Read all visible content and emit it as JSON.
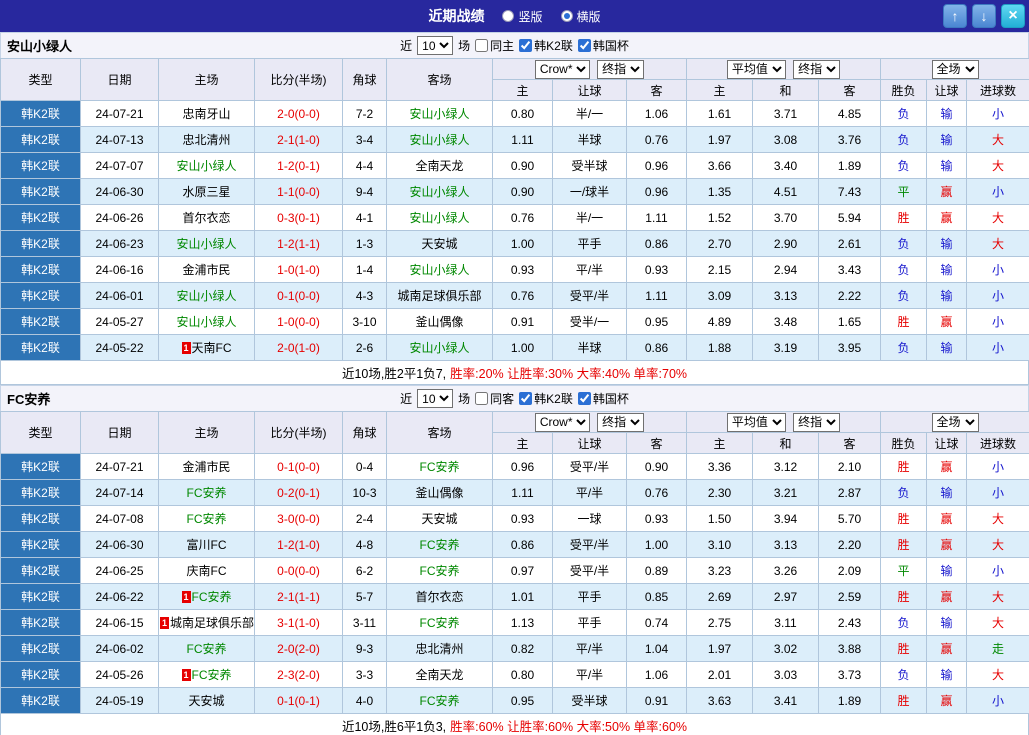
{
  "titlebar": {
    "title": "近期战绩",
    "modes": [
      {
        "label": "竖版",
        "selected": false
      },
      {
        "label": "横版",
        "selected": true
      }
    ],
    "up_icon": "↑",
    "down_icon": "↓",
    "close_icon": "×"
  },
  "badge_label": "1",
  "colors": {
    "red": "#E60000",
    "blue": "#1515CD",
    "green": "#008800",
    "type_bg": "#2E74B5"
  },
  "result_color_map": {
    "胜": "red",
    "平": "green",
    "负": "blue",
    "赢": "red",
    "输": "blue",
    "大": "red",
    "小": "blue",
    "走": "green"
  },
  "table_header": {
    "type": "类型",
    "date": "日期",
    "home": "主场",
    "score": "比分(半场)",
    "corner": "角球",
    "away": "客场",
    "bookmaker_select": "Crow*",
    "final_select": "终指",
    "avg_select": "平均值",
    "final_select2": "终指",
    "fullmatch_select": "全场",
    "sub": {
      "home": "主",
      "handicap": "让球",
      "away": "客",
      "home2": "主",
      "draw": "和",
      "away2": "客",
      "result": "胜负",
      "handicap_result": "让球",
      "goals": "进球数"
    }
  },
  "sections": [
    {
      "team": "安山小绿人",
      "filters": {
        "recent_label": "近",
        "recent_value": "10",
        "matches_label": "场",
        "same_label": "同主",
        "same_checked": false,
        "league_label": "韩K2联",
        "league_checked": true,
        "cup_label": "韩国杯",
        "cup_checked": true
      },
      "rows": [
        {
          "league": "韩K2联",
          "date": "24-07-21",
          "home": "忠南牙山",
          "home_focus": false,
          "home_badge": false,
          "score": "2-0(0-0)",
          "corner": "7-2",
          "away": "安山小绿人",
          "away_focus": true,
          "asian": [
            "0.80",
            "半/一",
            "1.06"
          ],
          "euro": [
            "1.61",
            "3.71",
            "4.85"
          ],
          "results": [
            "负",
            "输",
            "小"
          ]
        },
        {
          "league": "韩K2联",
          "date": "24-07-13",
          "home": "忠北清州",
          "home_focus": false,
          "home_badge": false,
          "score": "2-1(1-0)",
          "corner": "3-4",
          "away": "安山小绿人",
          "away_focus": true,
          "asian": [
            "1.11",
            "半球",
            "0.76"
          ],
          "euro": [
            "1.97",
            "3.08",
            "3.76"
          ],
          "results": [
            "负",
            "输",
            "大"
          ]
        },
        {
          "league": "韩K2联",
          "date": "24-07-07",
          "home": "安山小绿人",
          "home_focus": true,
          "home_badge": false,
          "score": "1-2(0-1)",
          "corner": "4-4",
          "away": "全南天龙",
          "away_focus": false,
          "asian": [
            "0.90",
            "受半球",
            "0.96"
          ],
          "euro": [
            "3.66",
            "3.40",
            "1.89"
          ],
          "results": [
            "负",
            "输",
            "大"
          ]
        },
        {
          "league": "韩K2联",
          "date": "24-06-30",
          "home": "水原三星",
          "home_focus": false,
          "home_badge": false,
          "score": "1-1(0-0)",
          "corner": "9-4",
          "away": "安山小绿人",
          "away_focus": true,
          "asian": [
            "0.90",
            "一/球半",
            "0.96"
          ],
          "euro": [
            "1.35",
            "4.51",
            "7.43"
          ],
          "results": [
            "平",
            "赢",
            "小"
          ]
        },
        {
          "league": "韩K2联",
          "date": "24-06-26",
          "home": "首尔衣恋",
          "home_focus": false,
          "home_badge": false,
          "score": "0-3(0-1)",
          "corner": "4-1",
          "away": "安山小绿人",
          "away_focus": true,
          "asian": [
            "0.76",
            "半/一",
            "1.11"
          ],
          "euro": [
            "1.52",
            "3.70",
            "5.94"
          ],
          "results": [
            "胜",
            "赢",
            "大"
          ]
        },
        {
          "league": "韩K2联",
          "date": "24-06-23",
          "home": "安山小绿人",
          "home_focus": true,
          "home_badge": false,
          "score": "1-2(1-1)",
          "corner": "1-3",
          "away": "天安城",
          "away_focus": false,
          "asian": [
            "1.00",
            "平手",
            "0.86"
          ],
          "euro": [
            "2.70",
            "2.90",
            "2.61"
          ],
          "results": [
            "负",
            "输",
            "大"
          ]
        },
        {
          "league": "韩K2联",
          "date": "24-06-16",
          "home": "金浦市民",
          "home_focus": false,
          "home_badge": false,
          "score": "1-0(1-0)",
          "corner": "1-4",
          "away": "安山小绿人",
          "away_focus": true,
          "asian": [
            "0.93",
            "平/半",
            "0.93"
          ],
          "euro": [
            "2.15",
            "2.94",
            "3.43"
          ],
          "results": [
            "负",
            "输",
            "小"
          ]
        },
        {
          "league": "韩K2联",
          "date": "24-06-01",
          "home": "安山小绿人",
          "home_focus": true,
          "home_badge": false,
          "score": "0-1(0-0)",
          "corner": "4-3",
          "away": "城南足球俱乐部",
          "away_focus": false,
          "asian": [
            "0.76",
            "受平/半",
            "1.11"
          ],
          "euro": [
            "3.09",
            "3.13",
            "2.22"
          ],
          "results": [
            "负",
            "输",
            "小"
          ]
        },
        {
          "league": "韩K2联",
          "date": "24-05-27",
          "home": "安山小绿人",
          "home_focus": true,
          "home_badge": false,
          "score": "1-0(0-0)",
          "corner": "3-10",
          "away": "釜山偶像",
          "away_focus": false,
          "asian": [
            "0.91",
            "受半/一",
            "0.95"
          ],
          "euro": [
            "4.89",
            "3.48",
            "1.65"
          ],
          "results": [
            "胜",
            "赢",
            "小"
          ]
        },
        {
          "league": "韩K2联",
          "date": "24-05-22",
          "home": "天南FC",
          "home_focus": false,
          "home_badge": true,
          "score": "2-0(1-0)",
          "corner": "2-6",
          "away": "安山小绿人",
          "away_focus": true,
          "asian": [
            "1.00",
            "半球",
            "0.86"
          ],
          "euro": [
            "1.88",
            "3.19",
            "3.95"
          ],
          "results": [
            "负",
            "输",
            "小"
          ]
        }
      ],
      "summary": {
        "prefix": "近10场,胜2平1负7,",
        "stats": "胜率:20% 让胜率:30% 大率:40% 单率:70%"
      }
    },
    {
      "team": "FC安养",
      "filters": {
        "recent_label": "近",
        "recent_value": "10",
        "matches_label": "场",
        "same_label": "同客",
        "same_checked": false,
        "league_label": "韩K2联",
        "league_checked": true,
        "cup_label": "韩国杯",
        "cup_checked": true
      },
      "rows": [
        {
          "league": "韩K2联",
          "date": "24-07-21",
          "home": "金浦市民",
          "home_focus": false,
          "home_badge": false,
          "score": "0-1(0-0)",
          "corner": "0-4",
          "away": "FC安养",
          "away_focus": true,
          "asian": [
            "0.96",
            "受平/半",
            "0.90"
          ],
          "euro": [
            "3.36",
            "3.12",
            "2.10"
          ],
          "results": [
            "胜",
            "赢",
            "小"
          ]
        },
        {
          "league": "韩K2联",
          "date": "24-07-14",
          "home": "FC安养",
          "home_focus": true,
          "home_badge": false,
          "score": "0-2(0-1)",
          "corner": "10-3",
          "away": "釜山偶像",
          "away_focus": false,
          "asian": [
            "1.11",
            "平/半",
            "0.76"
          ],
          "euro": [
            "2.30",
            "3.21",
            "2.87"
          ],
          "results": [
            "负",
            "输",
            "小"
          ]
        },
        {
          "league": "韩K2联",
          "date": "24-07-08",
          "home": "FC安养",
          "home_focus": true,
          "home_badge": false,
          "score": "3-0(0-0)",
          "corner": "2-4",
          "away": "天安城",
          "away_focus": false,
          "asian": [
            "0.93",
            "一球",
            "0.93"
          ],
          "euro": [
            "1.50",
            "3.94",
            "5.70"
          ],
          "results": [
            "胜",
            "赢",
            "大"
          ]
        },
        {
          "league": "韩K2联",
          "date": "24-06-30",
          "home": "富川FC",
          "home_focus": false,
          "home_badge": false,
          "score": "1-2(1-0)",
          "corner": "4-8",
          "away": "FC安养",
          "away_focus": true,
          "asian": [
            "0.86",
            "受平/半",
            "1.00"
          ],
          "euro": [
            "3.10",
            "3.13",
            "2.20"
          ],
          "results": [
            "胜",
            "赢",
            "大"
          ]
        },
        {
          "league": "韩K2联",
          "date": "24-06-25",
          "home": "庆南FC",
          "home_focus": false,
          "home_badge": false,
          "score": "0-0(0-0)",
          "corner": "6-2",
          "away": "FC安养",
          "away_focus": true,
          "asian": [
            "0.97",
            "受平/半",
            "0.89"
          ],
          "euro": [
            "3.23",
            "3.26",
            "2.09"
          ],
          "results": [
            "平",
            "输",
            "小"
          ]
        },
        {
          "league": "韩K2联",
          "date": "24-06-22",
          "home": "FC安养",
          "home_focus": true,
          "home_badge": true,
          "score": "2-1(1-1)",
          "corner": "5-7",
          "away": "首尔衣恋",
          "away_focus": false,
          "asian": [
            "1.01",
            "平手",
            "0.85"
          ],
          "euro": [
            "2.69",
            "2.97",
            "2.59"
          ],
          "results": [
            "胜",
            "赢",
            "大"
          ]
        },
        {
          "league": "韩K2联",
          "date": "24-06-15",
          "home": "城南足球俱乐部",
          "home_focus": false,
          "home_badge": true,
          "score": "3-1(1-0)",
          "corner": "3-11",
          "away": "FC安养",
          "away_focus": true,
          "asian": [
            "1.13",
            "平手",
            "0.74"
          ],
          "euro": [
            "2.75",
            "3.11",
            "2.43"
          ],
          "results": [
            "负",
            "输",
            "大"
          ]
        },
        {
          "league": "韩K2联",
          "date": "24-06-02",
          "home": "FC安养",
          "home_focus": true,
          "home_badge": false,
          "score": "2-0(2-0)",
          "corner": "9-3",
          "away": "忠北清州",
          "away_focus": false,
          "asian": [
            "0.82",
            "平/半",
            "1.04"
          ],
          "euro": [
            "1.97",
            "3.02",
            "3.88"
          ],
          "results": [
            "胜",
            "赢",
            "走"
          ]
        },
        {
          "league": "韩K2联",
          "date": "24-05-26",
          "home": "FC安养",
          "home_focus": true,
          "home_badge": true,
          "score": "2-3(2-0)",
          "corner": "3-3",
          "away": "全南天龙",
          "away_focus": false,
          "asian": [
            "0.80",
            "平/半",
            "1.06"
          ],
          "euro": [
            "2.01",
            "3.03",
            "3.73"
          ],
          "results": [
            "负",
            "输",
            "大"
          ]
        },
        {
          "league": "韩K2联",
          "date": "24-05-19",
          "home": "天安城",
          "home_focus": false,
          "home_badge": false,
          "score": "0-1(0-1)",
          "corner": "4-0",
          "away": "FC安养",
          "away_focus": true,
          "asian": [
            "0.95",
            "受半球",
            "0.91"
          ],
          "euro": [
            "3.63",
            "3.41",
            "1.89"
          ],
          "results": [
            "胜",
            "赢",
            "小"
          ]
        }
      ],
      "summary": {
        "prefix": "近10场,胜6平1负3,",
        "stats": "胜率:60% 让胜率:60% 大率:50% 单率:60%"
      }
    }
  ]
}
